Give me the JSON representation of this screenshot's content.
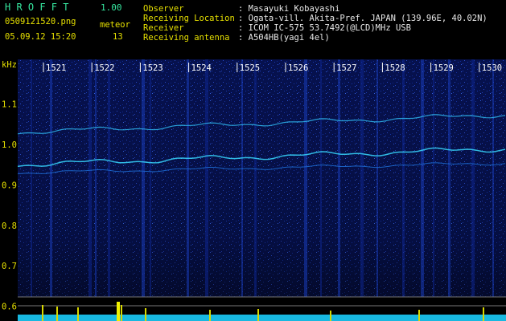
{
  "header": {
    "app_title": "H R O F F T",
    "version": "1.00",
    "filename": "0509121520.png",
    "datetime": "05.09.12 15:20",
    "meteor_label": "meteor",
    "meteor_count": "13",
    "fields": [
      {
        "label": "Observer",
        "value": ": Masayuki Kobayashi"
      },
      {
        "label": "Receiving Location",
        "value": ": Ogata-vill. Akita-Pref. JAPAN (139.96E, 40.02N)"
      },
      {
        "label": "Receiver",
        "value": ": ICOM IC-575 53.7492(@LCD)MHz USB"
      },
      {
        "label": "Receiving antenna",
        "value": ": A504HB(yagi 4el)"
      }
    ]
  },
  "colors": {
    "background": "#000000",
    "spectrogram": "#0a1a6a",
    "trace": "#38d8ff",
    "label_yellow": "#e6e000",
    "title_green": "#36e8a0",
    "baseline_cyan": "#20e8ff",
    "peak_yellow": "#f0f000"
  },
  "chart_data": {
    "type": "heatmap",
    "ylabel": "kHz",
    "y_ticks": [
      "1.1",
      "1.0",
      "0.9",
      "0.8",
      "0.7",
      "0.6"
    ],
    "x_ticks": [
      "1521",
      "1522",
      "1523",
      "1524",
      "1525",
      "1526",
      "1527",
      "1528",
      "1529",
      "1530"
    ],
    "ylim": [
      0.58,
      1.2
    ]
  }
}
